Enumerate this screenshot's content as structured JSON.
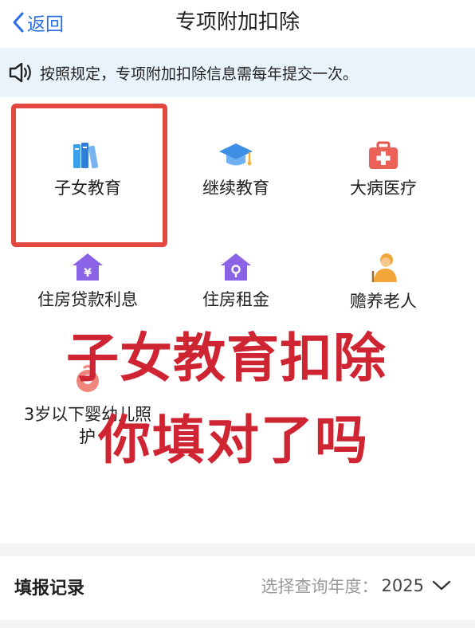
{
  "header": {
    "back_label": "返回",
    "title": "专项附加扣除"
  },
  "notice": {
    "icon": "speaker-icon",
    "text": "按照规定，专项附加扣除信息需每年提交一次。"
  },
  "items": [
    {
      "label": "子女教育",
      "icon": "books-icon"
    },
    {
      "label": "继续教育",
      "icon": "graduation-cap-icon"
    },
    {
      "label": "大病医疗",
      "icon": "medical-kit-icon"
    },
    {
      "label": "住房贷款利息",
      "icon": "house-yuan-icon"
    },
    {
      "label": "住房租金",
      "icon": "house-key-icon"
    },
    {
      "label": "赡养老人",
      "icon": "elderly-person-icon"
    },
    {
      "label_line1": "3岁以下婴幼儿照",
      "label_line2": "护",
      "icon": "baby-icon"
    }
  ],
  "overlay": {
    "line1": "子女教育扣除",
    "line2": "你填对了吗"
  },
  "records": {
    "title": "填报记录",
    "year_label": "选择查询年度：",
    "year_value": "2025"
  },
  "colors": {
    "accent_blue": "#2a6de8",
    "highlight_red": "#e3473f",
    "overlay_red": "#cf2533",
    "notice_bg": "#e9f3fc"
  }
}
